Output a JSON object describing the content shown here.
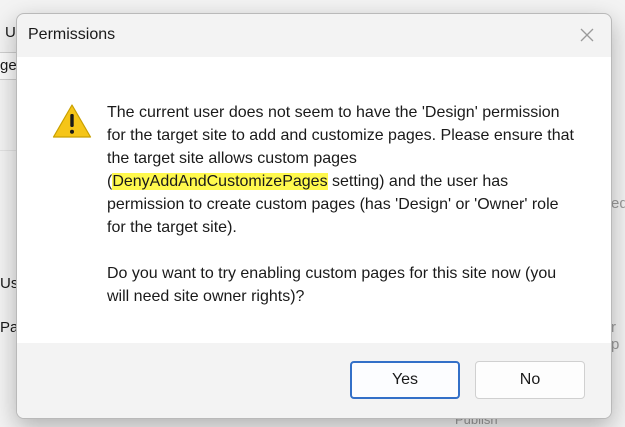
{
  "background": {
    "fragments": [
      "U",
      "ge",
      "Us",
      "Pa",
      "ed",
      "r p",
      "Publish"
    ]
  },
  "dialog": {
    "title": "Permissions",
    "icon": "warning-icon",
    "message": {
      "line_before": "The current user does not seem to have the 'Design' permission for the target site to add and customize pages. Please ensure that the target site allows custom pages (",
      "highlight": "DenyAddAndCustomizePages",
      "line_after": " setting) and the user has permission to create custom pages (has 'Design' or 'Owner' role for the target site).",
      "question": "Do you want to try enabling custom pages for this site now (you will need site owner rights)?"
    },
    "buttons": {
      "yes": "Yes",
      "no": "No"
    }
  },
  "colors": {
    "highlight": "#fff94d",
    "accent": "#3370c8",
    "warning": "#f5c518"
  }
}
